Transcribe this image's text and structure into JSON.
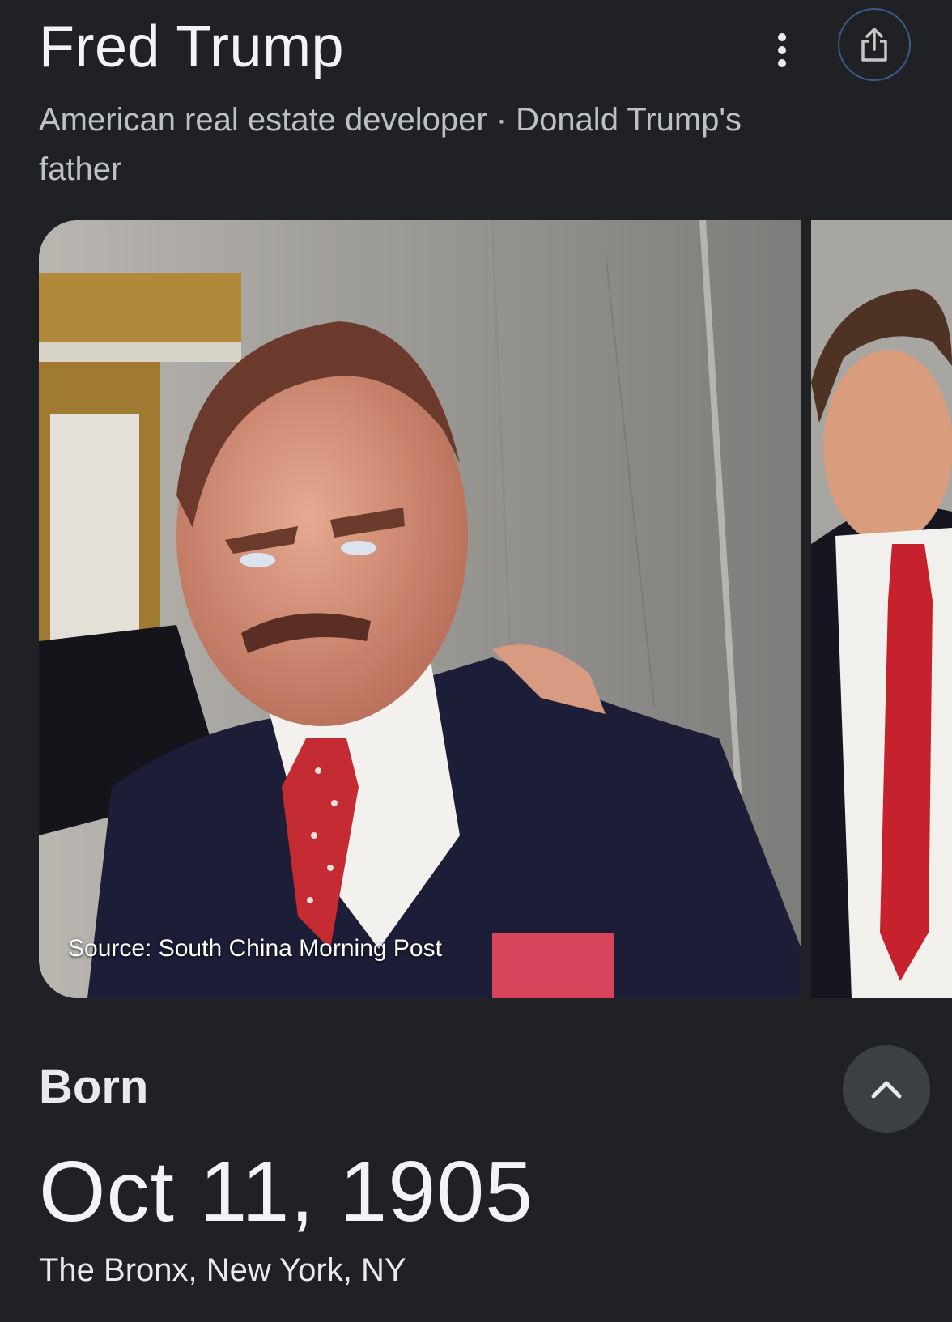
{
  "header": {
    "title": "Fred Trump",
    "subtitle": "American real estate developer · Donald Trump's father",
    "more_icon": "more-vert-icon",
    "share_icon": "share-icon"
  },
  "images": {
    "main_source": "Source: South China Morning Post"
  },
  "born": {
    "label": "Born",
    "date": "Oct 11, 1905",
    "place": "The Bronx, New York, NY",
    "collapse_icon": "chevron-up-icon"
  },
  "colors": {
    "background": "#202124",
    "share_border": "#3c5a8c",
    "collapse_bg": "#3c4043"
  }
}
